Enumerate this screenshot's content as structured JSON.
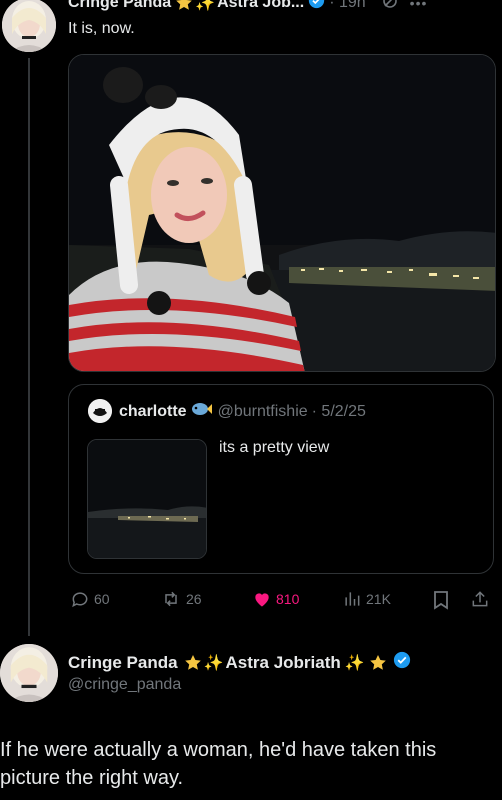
{
  "top_tweet": {
    "display_name": "Cringe Panda",
    "second_name": "Astra Job...",
    "time": "· 19h",
    "text": "It is, now."
  },
  "quoted_tweet": {
    "display_name": "charlotte",
    "handle": "@burntfishie",
    "date": "· 5/2/25",
    "text": "its a pretty view"
  },
  "actions": {
    "replies": "60",
    "retweets": "26",
    "likes": "810",
    "views": "21K"
  },
  "reply_tweet": {
    "display_name_1": "Cringe Panda",
    "display_name_2": "Astra Jobriath",
    "handle": "@cringe_panda",
    "text": "If he were actually a woman, he'd have taken this picture the right way."
  },
  "colors": {
    "background": "#000000",
    "text": "#e7e9ea",
    "muted": "#71767b",
    "like": "#f91880",
    "verified": "#1d9bf0"
  },
  "icons": [
    "sparkle-icon",
    "star-icon",
    "verified-icon",
    "more-icon",
    "grok-icon",
    "reply-icon",
    "retweet-icon",
    "heart-icon",
    "views-icon",
    "bookmark-icon",
    "share-icon"
  ]
}
